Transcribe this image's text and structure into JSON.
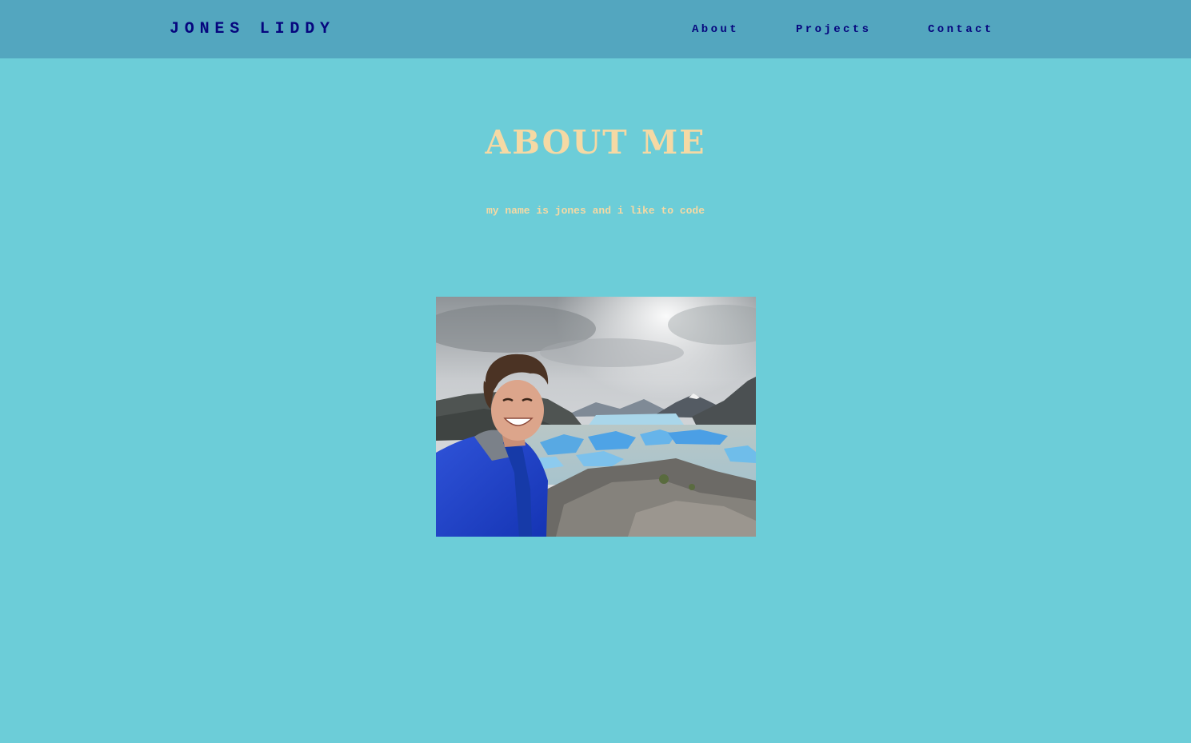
{
  "header": {
    "brand": "JONES LIDDY",
    "nav": {
      "about": "About",
      "projects": "Projects",
      "contact": "Contact"
    }
  },
  "main": {
    "title": "ABOUT ME",
    "tagline": "my name is jones and i like to code",
    "photo_alt": "selfie at a glacier with icebergs and mountains"
  },
  "colors": {
    "background": "#6ccdd8",
    "navbar": "#53a6bf",
    "nav_text": "#06067e",
    "heading_text": "#f5d9a4"
  }
}
